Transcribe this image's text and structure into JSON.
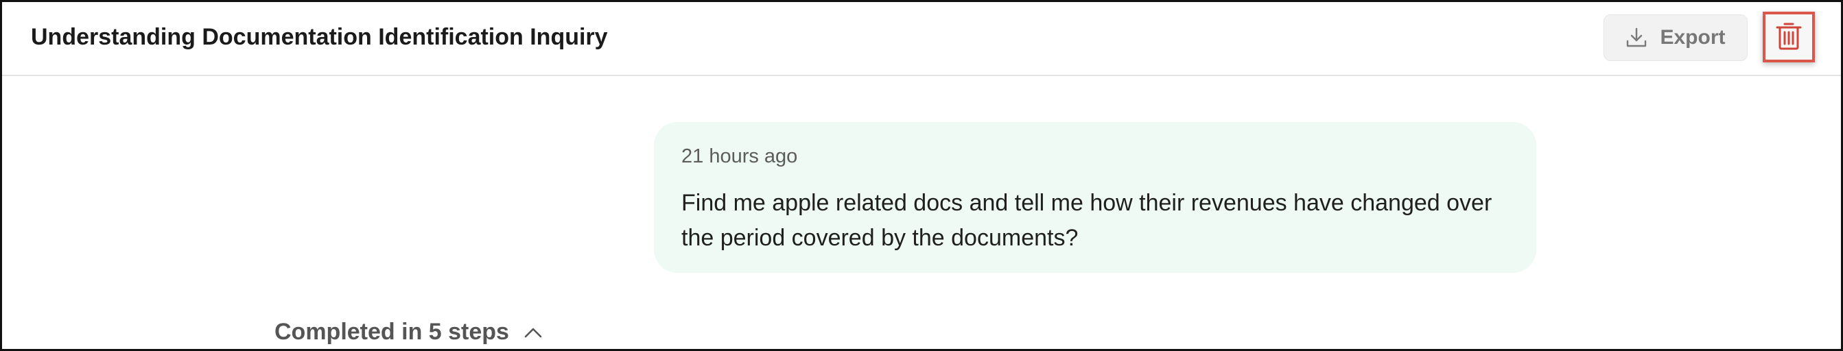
{
  "header": {
    "title": "Understanding Documentation Identification Inquiry",
    "export_label": "Export",
    "export_icon": "download-icon",
    "delete_icon": "trash-icon",
    "delete_highlight_color": "#d9574c"
  },
  "message": {
    "timestamp": "21 hours ago",
    "text": "Find me apple related docs and tell me how their revenues have changed over the period covered by the documents?",
    "bubble_color": "#eefaf3"
  },
  "steps": {
    "label": "Completed in 5 steps",
    "toggle_icon": "chevron-up-icon"
  }
}
